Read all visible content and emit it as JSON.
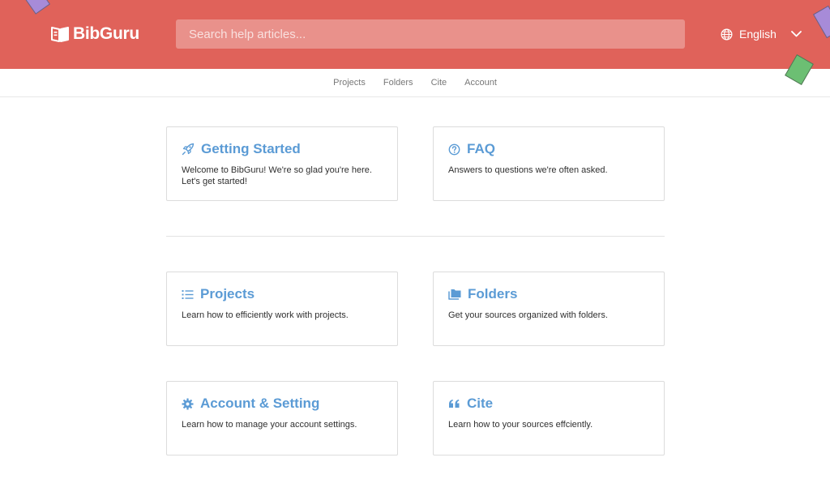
{
  "header": {
    "logo_text": "BibGuru",
    "search_placeholder": "Search help articles...",
    "language": "English",
    "accent_color": "#e0625a"
  },
  "nav": {
    "items": [
      "Projects",
      "Folders",
      "Cite",
      "Account"
    ]
  },
  "cards": [
    {
      "title": "Getting Started",
      "description": "Welcome to BibGuru! We're so glad you're here. Let's get started!",
      "icon": "rocket-icon"
    },
    {
      "title": "FAQ",
      "description": "Answers to questions we're often asked.",
      "icon": "question-circle-icon"
    },
    {
      "title": "Projects",
      "description": "Learn how to efficiently work with projects.",
      "icon": "list-icon"
    },
    {
      "title": "Folders",
      "description": "Get your sources organized with folders.",
      "icon": "folders-icon"
    },
    {
      "title": "Account & Setting",
      "description": "Learn how to manage your account settings.",
      "icon": "gear-icon"
    },
    {
      "title": "Cite",
      "description": "Learn how to your sources effciently.",
      "icon": "quote-icon"
    }
  ]
}
